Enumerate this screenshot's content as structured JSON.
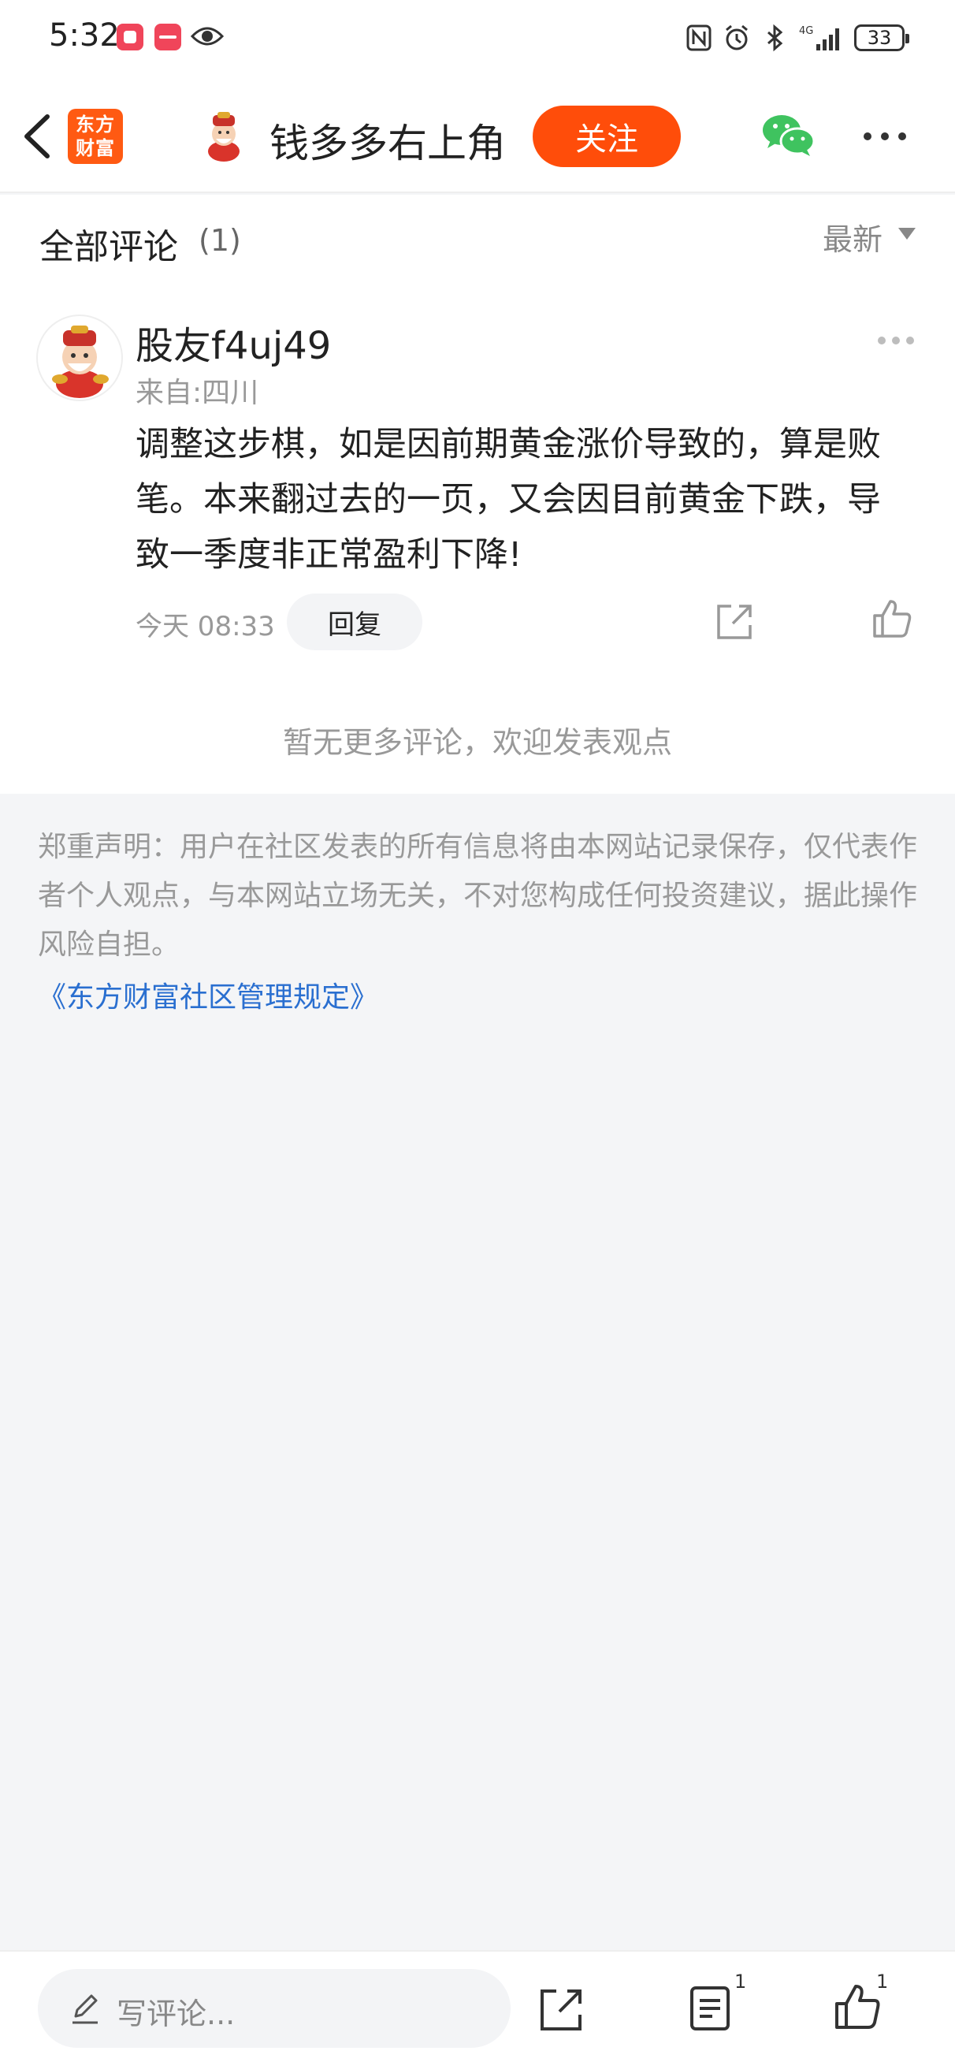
{
  "status_bar": {
    "time": "5:32",
    "network": "4G",
    "battery": "33",
    "icons": [
      "notification-app-icon",
      "notification-app-icon",
      "eye-icon",
      "nfc-icon",
      "alarm-icon",
      "bluetooth-icon",
      "signal-icon",
      "battery-icon"
    ]
  },
  "header": {
    "back_icon": "chevron-left-icon",
    "logo_text_line1": "东方",
    "logo_text_line2": "财富",
    "title": "钱多多右上角",
    "follow_label": "关注",
    "wechat_icon": "wechat-icon",
    "more_icon": "more-dots-icon",
    "accent_color": "#ff4d0a"
  },
  "comments_section": {
    "title": "全部评论",
    "count": "(1)",
    "sort_label": "最新",
    "comments": [
      {
        "username": "股友f4uj49",
        "location": "来自:四川",
        "text": "调整这步棋，如是因前期黄金涨价导致的，算是败笔。本来翻过去的一页，又会因目前黄金下跌，导致一季度非正常盈利下降!",
        "time": "今天 08:33",
        "reply_label": "回复"
      }
    ],
    "no_more_text": "暂无更多评论，欢迎发表观点"
  },
  "disclaimer": {
    "text": "郑重声明：用户在社区发表的所有信息将由本网站记录保存，仅代表作者个人观点，与本网站立场无关，不对您构成任何投资建议，据此操作风险自担。",
    "rules_link": "《东方财富社区管理规定》",
    "link_color": "#2a6fd0"
  },
  "bottom_bar": {
    "input_placeholder": "写评论...",
    "comment_count": "1",
    "like_count": "1"
  }
}
